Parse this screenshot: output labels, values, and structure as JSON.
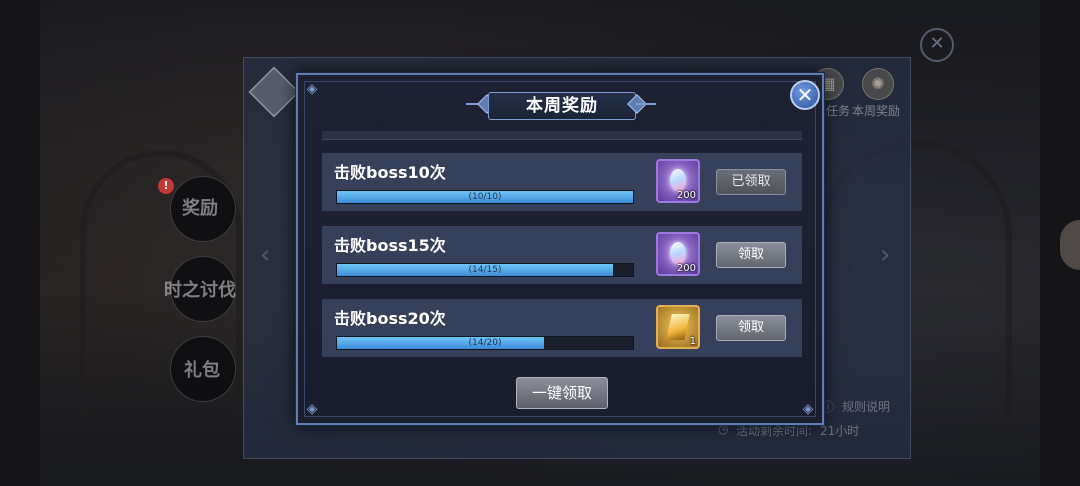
{
  "background": {
    "side_menu": [
      {
        "label": "奖励",
        "badge": "!"
      },
      {
        "label": "时之讨伐"
      },
      {
        "label": "礼包"
      }
    ],
    "top_icons": [
      {
        "label": "任务",
        "icon": "task-icon"
      },
      {
        "label": "本周奖励",
        "icon": "weekly-reward-icon"
      }
    ],
    "rules_link": "规则说明",
    "remaining_time_label": "活动剩余时间:",
    "remaining_time_value": "21小时"
  },
  "modal": {
    "title": "本周奖励",
    "close_icon": "close-icon",
    "rows": [
      {
        "title": "击败boss10次",
        "progress_text": "(10/10)",
        "progress": 1.0,
        "reward_type": "gem",
        "reward_count": "200",
        "button_label": "已领取",
        "claimed": true
      },
      {
        "title": "击败boss15次",
        "progress_text": "(14/15)",
        "progress": 0.9333,
        "reward_type": "gem",
        "reward_count": "200",
        "button_label": "领取",
        "claimed": false
      },
      {
        "title": "击败boss20次",
        "progress_text": "(14/20)",
        "progress": 0.7,
        "reward_type": "shard",
        "reward_count": "1",
        "button_label": "领取",
        "claimed": false
      }
    ],
    "claim_all_label": "一键领取"
  },
  "colors": {
    "accent": "#5d7db3",
    "progress": "#6ec6f7",
    "row_bg": "#36405a"
  }
}
